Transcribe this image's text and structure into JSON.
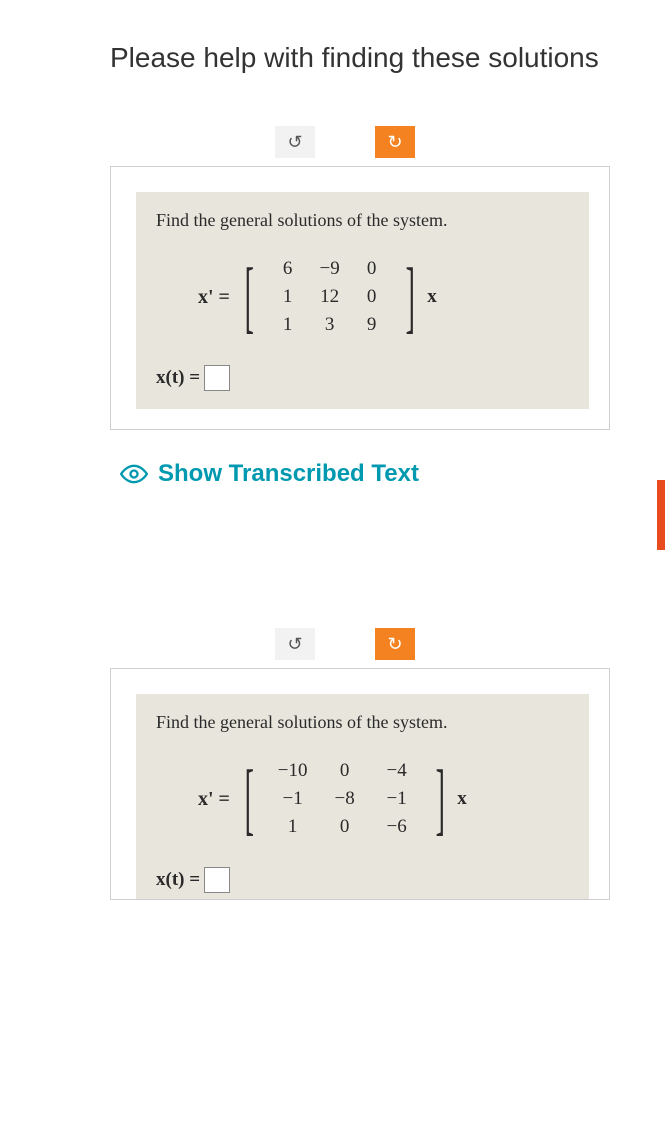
{
  "title": "Please help with finding these solutions",
  "rotate": {
    "ccw": "↺",
    "cw": "↻"
  },
  "problem1": {
    "heading": "Find the general solutions of the system.",
    "lhs": "x' =",
    "matrix": {
      "r1": {
        "c1": "6",
        "c2": "−9",
        "c3": "0"
      },
      "r2": {
        "c1": "1",
        "c2": "12",
        "c3": "0"
      },
      "r3": {
        "c1": "1",
        "c2": "3",
        "c3": "9"
      }
    },
    "trail": "x",
    "answer_lhs": "x(t) ="
  },
  "show_transcribed": "Show Transcribed Text",
  "problem2": {
    "heading": "Find the general solutions of the system.",
    "lhs": "x' =",
    "matrix": {
      "r1": {
        "c1": "−10",
        "c2": "0",
        "c3": "−4"
      },
      "r2": {
        "c1": "−1",
        "c2": "−8",
        "c3": "−1"
      },
      "r3": {
        "c1": "1",
        "c2": "0",
        "c3": "−6"
      }
    },
    "trail": "x",
    "answer_lhs": "x(t) ="
  }
}
